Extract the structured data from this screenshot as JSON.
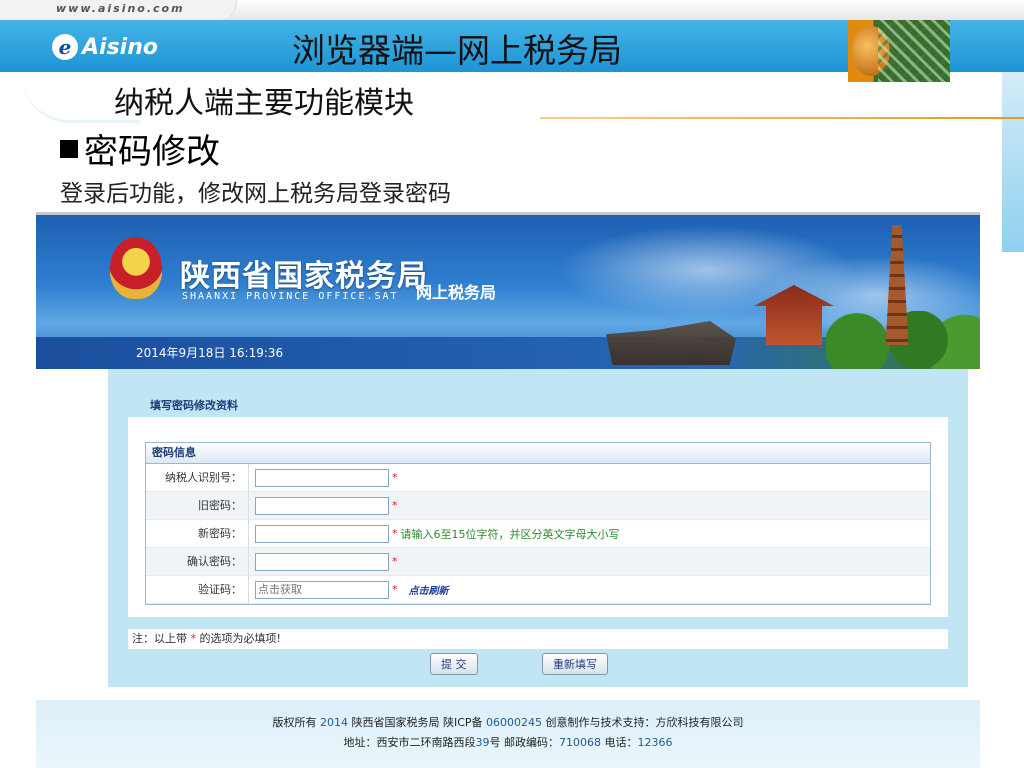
{
  "slide": {
    "url_text": "www.aisino.com",
    "logo_text": "Aisino",
    "title": "浏览器端—网上税务局",
    "subtitle": "纳税人端主要功能模块",
    "section_heading": "密码修改",
    "section_description": "登录后功能，修改网上税务局登录密码",
    "accent_color": "#1e94d6",
    "highlight_color": "#e39a1c"
  },
  "banner": {
    "bureau_name": "陕西省国家税务局",
    "bureau_name_en": "SHAANXI PROVINCE OFFICE.SAT",
    "site_name": "网上税务局",
    "datetime": "2014年9月18日  16:19:36",
    "emblem_icon": "national-emblem-icon"
  },
  "form": {
    "heading": "填写密码修改资料",
    "table_title": "密码信息",
    "fields": [
      {
        "label": "纳税人识别号：",
        "value": "",
        "placeholder": "",
        "required": "*",
        "hint": ""
      },
      {
        "label": "旧密码：",
        "value": "",
        "placeholder": "",
        "required": "*",
        "hint": ""
      },
      {
        "label": "新密码：",
        "value": "",
        "placeholder": "",
        "required": "*",
        "hint": "请输入6至15位字符，并区分英文字母大小写"
      },
      {
        "label": "确认密码：",
        "value": "",
        "placeholder": "",
        "required": "*",
        "hint": ""
      },
      {
        "label": "验证码：",
        "value": "",
        "placeholder": "点击获取",
        "required": "*",
        "hint": ""
      }
    ],
    "refresh_label": "点击刷新",
    "note_prefix": "注：以上带",
    "note_star": "*",
    "note_suffix": "的选项为必填项!",
    "submit_label": "提  交",
    "reset_label": "重新填写"
  },
  "footer": {
    "copyright_prefix": "版权所有",
    "year": "2014",
    "copyright_org": "陕西省国家税务局 陕ICP备",
    "icp_number": "06000245",
    "support": "创意制作与技术支持：方欣科技有限公司",
    "address_prefix": "地址：西安市二环南路西段",
    "address_number": "39",
    "address_suffix": "号 邮政编码：",
    "postcode": "710068",
    "phone_label": "电话：",
    "phone": "12366"
  }
}
